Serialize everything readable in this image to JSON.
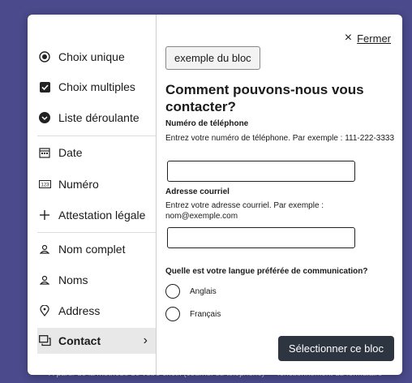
{
  "background_text": "À partir de la méthode de votre choix (courriel ou téléphone) — fonctionnement du formulaire",
  "sidebar": {
    "items": [
      {
        "label": "Choix unique",
        "icon": "radio-selected-icon"
      },
      {
        "label": "Choix multiples",
        "icon": "checkbox-checked-icon"
      },
      {
        "label": "Liste déroulante",
        "icon": "dropdown-circle-icon"
      },
      {
        "label": "Date",
        "icon": "calendar-icon"
      },
      {
        "label": "Numéro",
        "icon": "number-icon"
      },
      {
        "label": "Attestation légale",
        "icon": "plus-icon"
      },
      {
        "label": "Nom complet",
        "icon": "person-icon"
      },
      {
        "label": "Noms",
        "icon": "person-icon"
      },
      {
        "label": "Address",
        "icon": "location-pin-icon"
      },
      {
        "label": "Contact",
        "icon": "chat-icon",
        "chevron": "›"
      }
    ]
  },
  "close": {
    "icon": "×",
    "label": "Fermer"
  },
  "preview": {
    "chip": "exemple du bloc",
    "heading": "Comment pouvons-nous vous contacter?",
    "phone": {
      "label": "Numéro de téléphone",
      "hint": "Entrez votre numéro de téléphone. Par exemple : 111-222-3333",
      "value": ""
    },
    "email": {
      "label": "Adresse courriel",
      "hint": "Entrez votre adresse courriel. Par exemple : nom@exemple.com",
      "value": ""
    },
    "question": "Quelle est votre langue préférée de communication?",
    "options": [
      "Anglais",
      "Français"
    ]
  },
  "select_button": "Sélectionner ce bloc"
}
